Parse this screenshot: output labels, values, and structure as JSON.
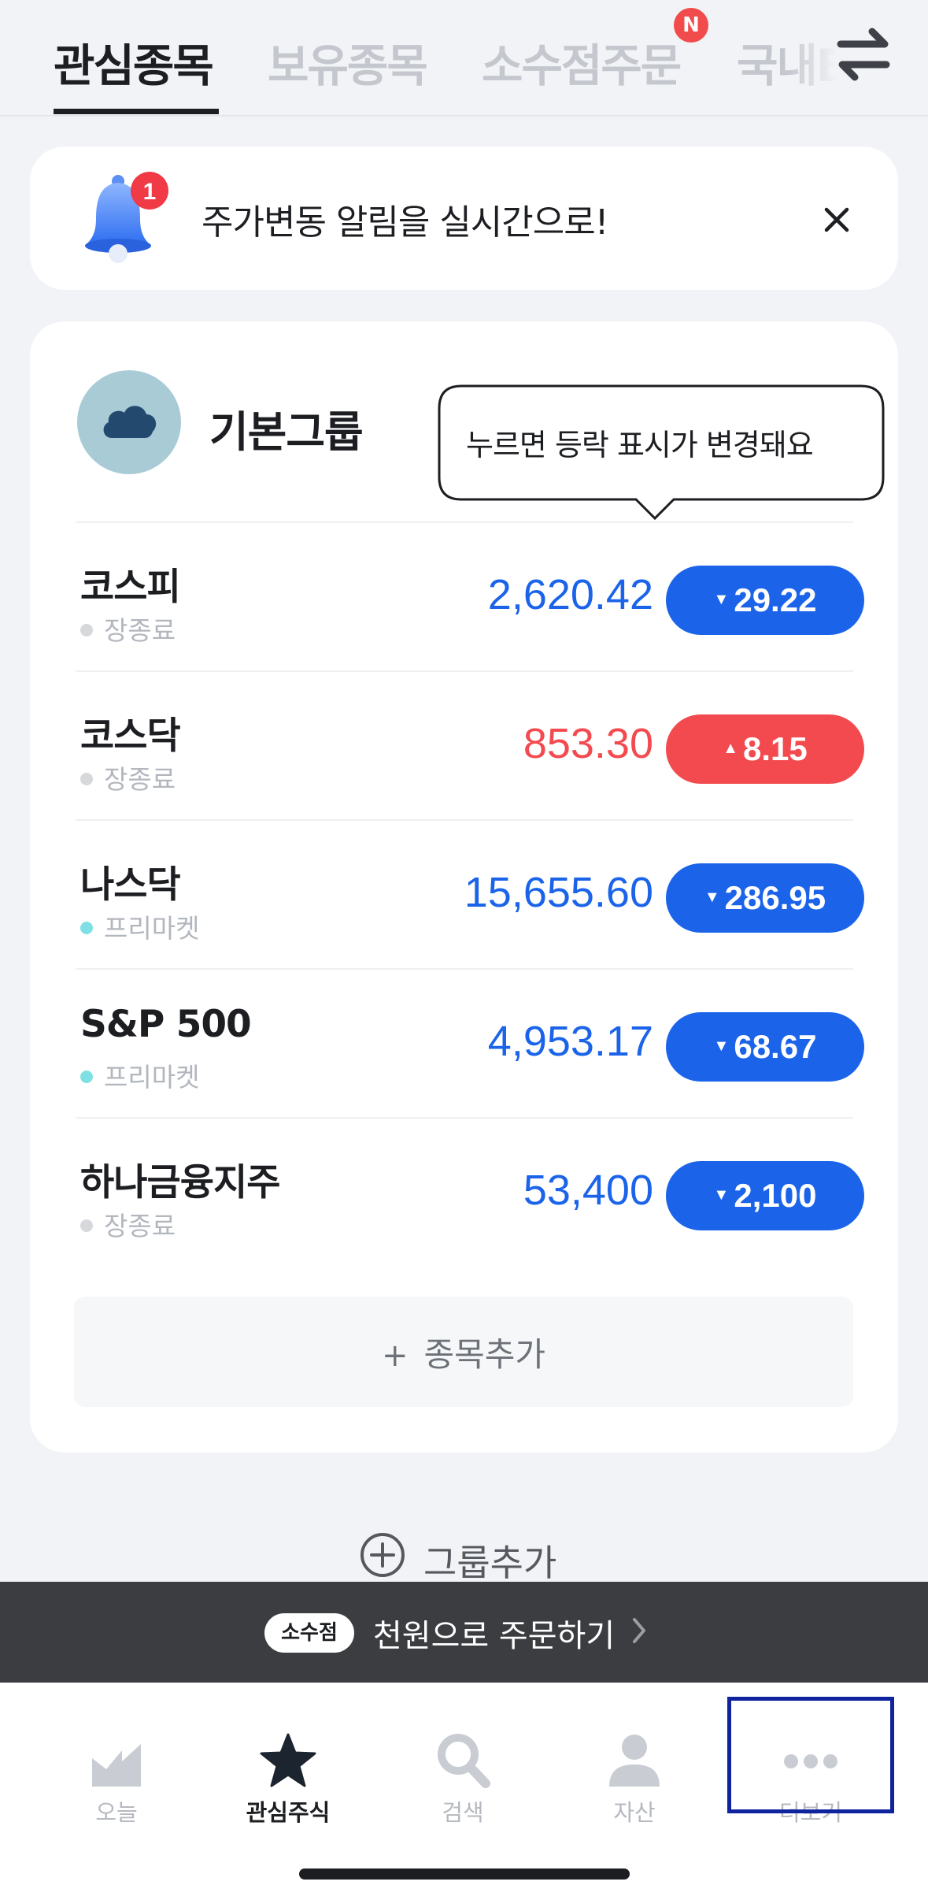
{
  "tabs": [
    {
      "label": "관심종목",
      "active": true
    },
    {
      "label": "보유종목",
      "active": false
    },
    {
      "label": "소수점주문",
      "active": false
    },
    {
      "label": "국내B",
      "active": false
    }
  ],
  "tab_new_badge": "N",
  "alert": {
    "bell_badge_count": "1",
    "text": "주가변동 알림을 실시간으로!"
  },
  "group": {
    "title": "기본그룹",
    "tooltip": "누르면 등락 표시가 변경돼요"
  },
  "stocks": [
    {
      "name": "코스피",
      "status": "장종료",
      "status_color": "#d6d8dc",
      "price": "2,620.42",
      "change": "29.22",
      "direction": "down"
    },
    {
      "name": "코스닥",
      "status": "장종료",
      "status_color": "#d6d8dc",
      "price": "853.30",
      "change": "8.15",
      "direction": "up"
    },
    {
      "name": "나스닥",
      "status": "프리마켓",
      "status_color": "#7fe0e4",
      "price": "15,655.60",
      "change": "286.95",
      "direction": "down"
    },
    {
      "name": "S&P 500",
      "status": "프리마켓",
      "status_color": "#7fe0e4",
      "price": "4,953.17",
      "change": "68.67",
      "direction": "down"
    },
    {
      "name": "하나금융지주",
      "status": "장종료",
      "status_color": "#d6d8dc",
      "price": "53,400",
      "change": "2,100",
      "direction": "down"
    }
  ],
  "add_stock": {
    "plus": "+",
    "label": "종목추가"
  },
  "add_group": {
    "label": "그룹추가"
  },
  "banner": {
    "badge": "소수점",
    "text": "천원으로 주문하기"
  },
  "nav": [
    {
      "label": "오늘",
      "icon": "chart-icon",
      "active": false
    },
    {
      "label": "관심주식",
      "icon": "star-icon",
      "active": true
    },
    {
      "label": "검색",
      "icon": "search-icon",
      "active": false
    },
    {
      "label": "자산",
      "icon": "person-icon",
      "active": false
    },
    {
      "label": "더보기",
      "icon": "more-icon",
      "active": false
    }
  ],
  "colors": {
    "down": "#1b64ea",
    "up": "#f34a4f",
    "accent_highlight": "#10239e"
  }
}
